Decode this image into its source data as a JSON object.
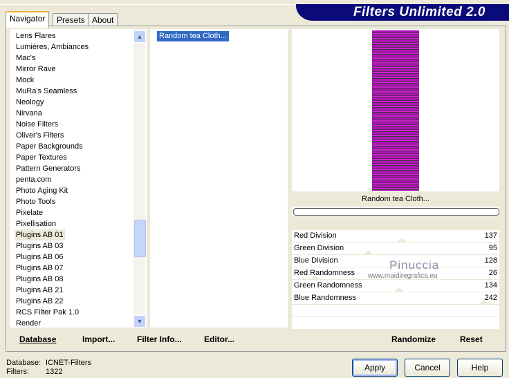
{
  "app": {
    "title": "Filters Unlimited 2.0"
  },
  "tabs": [
    "Navigator",
    "Presets",
    "About"
  ],
  "categories": [
    "Lens Flares",
    "Lumières, Ambiances",
    "Mac's",
    "Mirror Rave",
    "Mock",
    "MuRa's Seamless",
    "Neology",
    "Nirvana",
    "Noise Filters",
    "Oliver's Filters",
    "Paper Backgrounds",
    "Paper Textures",
    "Pattern Generators",
    "penta.com",
    "Photo Aging Kit",
    "Photo Tools",
    "Pixelate",
    "Pixellisation",
    "Plugins AB 01",
    "Plugins AB 03",
    "Plugins AB 06",
    "Plugins AB 07",
    "Plugins AB 08",
    "Plugins AB 21",
    "Plugins AB 22",
    "RCS Filter Pak 1.0",
    "Render"
  ],
  "selected_category": "Plugins AB 01",
  "filters": [
    "Random tea Cloth..."
  ],
  "preview": {
    "caption": "Random tea Cloth...",
    "progress": 0
  },
  "params": [
    {
      "label": "Red Division",
      "value": 137
    },
    {
      "label": "Green Division",
      "value": 95
    },
    {
      "label": "Blue Division",
      "value": 128
    },
    {
      "label": "Red Randomness",
      "value": 26
    },
    {
      "label": "Green Randomness",
      "value": 134
    },
    {
      "label": "Blue Randomness",
      "value": 242
    }
  ],
  "param_max": 255,
  "watermark": {
    "name": "Pinuccia",
    "url": "www.maidiregrafica.eu"
  },
  "bottom_bar": {
    "database": "Database",
    "import": "Import...",
    "filter_info": "Filter Info...",
    "editor": "Editor...",
    "randomize": "Randomize",
    "reset": "Reset"
  },
  "footer": {
    "database_label": "Database:",
    "database_value": "ICNET-Filters",
    "filters_label": "Filters:",
    "filters_value": "1322"
  },
  "buttons": {
    "apply": "Apply",
    "cancel": "Cancel",
    "help": "Help"
  }
}
